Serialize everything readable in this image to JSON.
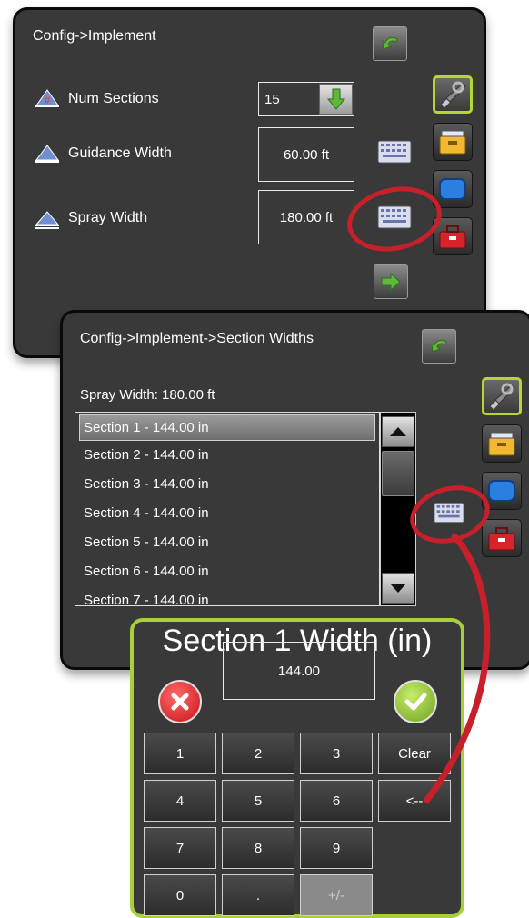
{
  "implement_screen": {
    "breadcrumb": "Config->Implement",
    "rows": [
      {
        "label": "Num Sections",
        "value": "15",
        "icon": "num-sections-icon"
      },
      {
        "label": "Guidance Width",
        "value": "60.00 ft",
        "icon": "guidance-width-icon"
      },
      {
        "label": "Spray Width",
        "value": "180.00 ft",
        "icon": "spray-width-icon"
      }
    ],
    "buttons": {
      "back": "back-arrow-icon",
      "next": "next-arrow-icon",
      "dropdown": "down-arrow-icon",
      "keyboard": "keyboard-icon"
    }
  },
  "section_widths_screen": {
    "breadcrumb": "Config->Implement->Section Widths",
    "spray_width_label": "Spray Width: 180.00 ft",
    "sections": [
      "Section 1 - 144.00 in",
      "Section 2 - 144.00 in",
      "Section 3 - 144.00 in",
      "Section 4 - 144.00 in",
      "Section 5 - 144.00 in",
      "Section 6 - 144.00 in",
      "Section 7 - 144.00 in"
    ],
    "selected_index": 0
  },
  "side_tabs": [
    "configuration-tools-icon",
    "data-management-toolbox-icon",
    "console-display-icon",
    "tools-toolbox-icon"
  ],
  "keypad": {
    "title": "Section 1 Width (in)",
    "value": "144.00",
    "keys": [
      [
        "1",
        "2",
        "3",
        "Clear"
      ],
      [
        "4",
        "5",
        "6",
        "<--"
      ],
      [
        "7",
        "8",
        "9",
        ""
      ],
      [
        "0",
        ".",
        "+/-",
        ""
      ]
    ],
    "disabled_key": "+/-",
    "cancel_icon": "cancel-x-icon",
    "accept_icon": "accept-check-icon"
  },
  "colors": {
    "panel_bg": "#3a393a",
    "accent_green": "#a7cf3a",
    "callout_red": "#c8202a",
    "arrow_green": "#5fb83a"
  }
}
